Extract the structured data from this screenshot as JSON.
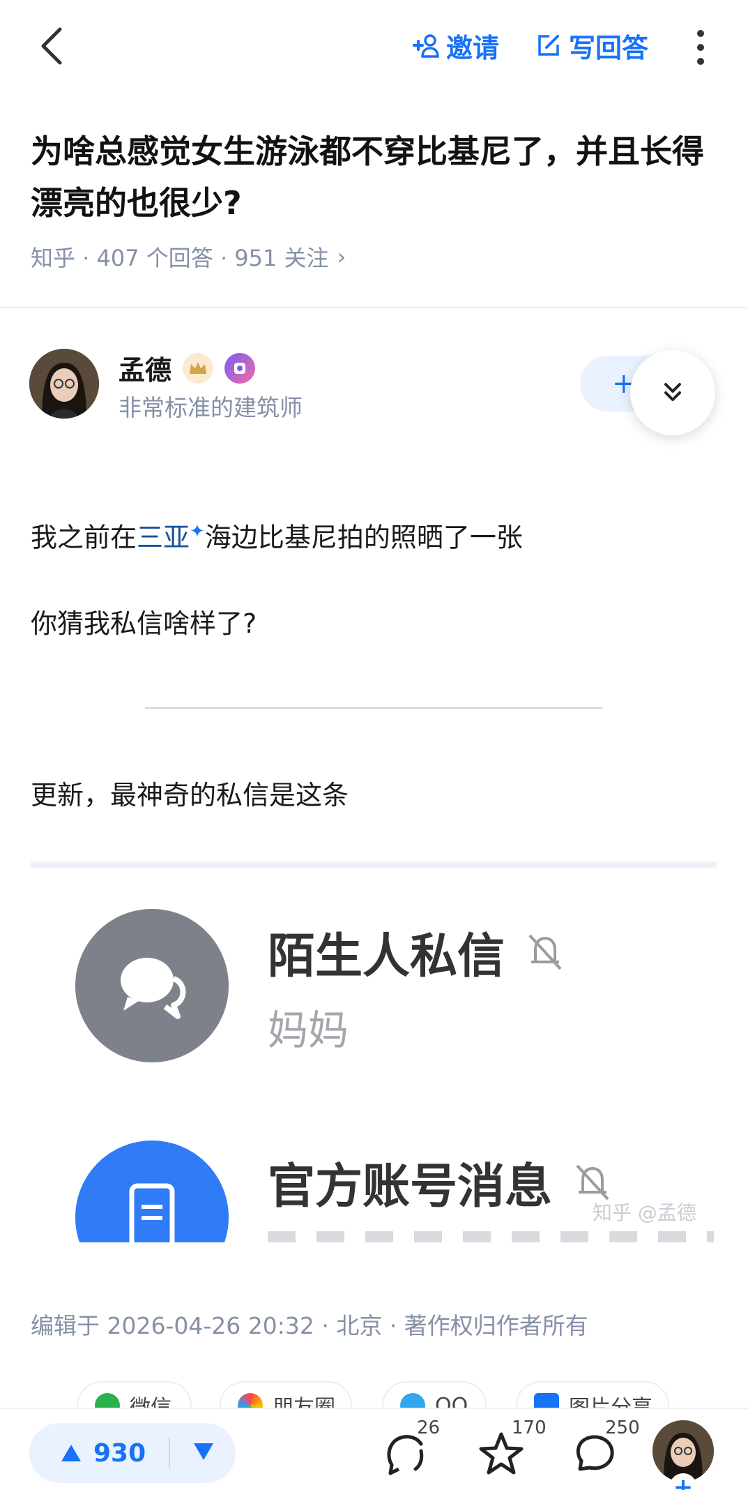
{
  "topbar": {
    "invite_label": "邀请",
    "write_label": "写回答"
  },
  "question": {
    "title": "为啥总感觉女生游泳都不穿比基尼了，并且长得漂亮的也很少?",
    "meta": "知乎 · 407  个回答 · 951  关注",
    "chevron": "›"
  },
  "author": {
    "name": "孟德",
    "bio": "非常标准的建筑师",
    "follow_label": "+"
  },
  "content": {
    "p1_before": "我之前在",
    "p1_link": "三亚",
    "p1_sparkle": "✦",
    "p1_after": "海边比基尼拍的照晒了一张",
    "p2": "你猜我私信啥样了?",
    "p3": "更新，最神奇的私信是这条"
  },
  "embedded": {
    "item1_title": "陌生人私信",
    "item1_sub": "妈妈",
    "item2_title": "官方账号消息",
    "watermark": "知乎 @孟德"
  },
  "edit_meta": "编辑于  2026-04-26  20:32 · 北京 · 著作权归作者所有",
  "share": [
    "微信",
    "朋友圈",
    "QQ",
    "图片分享"
  ],
  "bottom": {
    "upvotes": "930",
    "comments_count": "26",
    "favorites_count": "170",
    "reply_count": "250",
    "add_label": "+"
  },
  "colors": {
    "accent": "#1772f6",
    "meta_gray": "#8590a6",
    "link": "#175199"
  }
}
